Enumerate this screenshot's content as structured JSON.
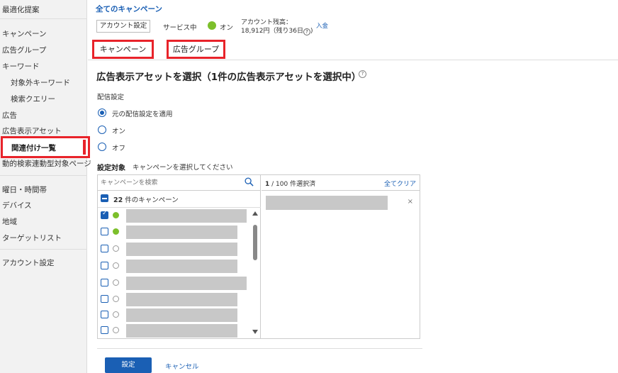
{
  "sidebar": {
    "items": [
      {
        "label": "最適化提案"
      },
      {
        "label": "キャンペーン"
      },
      {
        "label": "広告グループ"
      },
      {
        "label": "キーワード"
      },
      {
        "label": "対象外キーワード"
      },
      {
        "label": "検索クエリー"
      },
      {
        "label": "広告"
      },
      {
        "label": "広告表示アセット"
      },
      {
        "label": "関連付け一覧"
      },
      {
        "label": "動的検索連動型対象ページ"
      },
      {
        "label": "曜日・時間帯"
      },
      {
        "label": "デバイス"
      },
      {
        "label": "地域"
      },
      {
        "label": "ターゲットリスト"
      },
      {
        "label": "アカウント設定"
      }
    ]
  },
  "header": {
    "breadcrumb": "全てのキャンペーン",
    "account_settings": "アカウント設定",
    "service_label": "サービス中",
    "service_state": "オン",
    "balance_label": "アカウント残高：",
    "balance_value": "18,912円（残り36日",
    "deposit": "入金"
  },
  "tabs": [
    {
      "label": "キャンペーン"
    },
    {
      "label": "広告グループ"
    }
  ],
  "main": {
    "heading": "広告表示アセットを選択（1件の広告表示アセットを選択中）",
    "delivery_label": "配信設定",
    "radios": [
      {
        "label": "元の配信設定を適用",
        "selected": true
      },
      {
        "label": "オン",
        "selected": false
      },
      {
        "label": "オフ",
        "selected": false
      }
    ],
    "target_label": "設定対象",
    "target_hint": "キャンペーンを選択してください"
  },
  "picker": {
    "search_placeholder": "キャンペーンを検索",
    "count_num": "22",
    "count_suffix": "件のキャンペーン",
    "rows": [
      {
        "checked": true,
        "status": "green"
      },
      {
        "checked": false,
        "status": "green"
      },
      {
        "checked": false,
        "status": "empty"
      },
      {
        "checked": false,
        "status": "empty"
      },
      {
        "checked": false,
        "status": "empty"
      },
      {
        "checked": false,
        "status": "empty"
      },
      {
        "checked": false,
        "status": "empty"
      },
      {
        "checked": false,
        "status": "empty"
      }
    ],
    "selected_count": "1",
    "selected_total": "/ 100 件選択済",
    "clear_all": "全てクリア",
    "remove": "×"
  },
  "footer": {
    "set_button": "設定",
    "cancel_button": "キャンセル"
  },
  "colors": {
    "accent": "#1a5fb4",
    "highlight": "#e8232a",
    "status_green": "#7cbf2b"
  }
}
